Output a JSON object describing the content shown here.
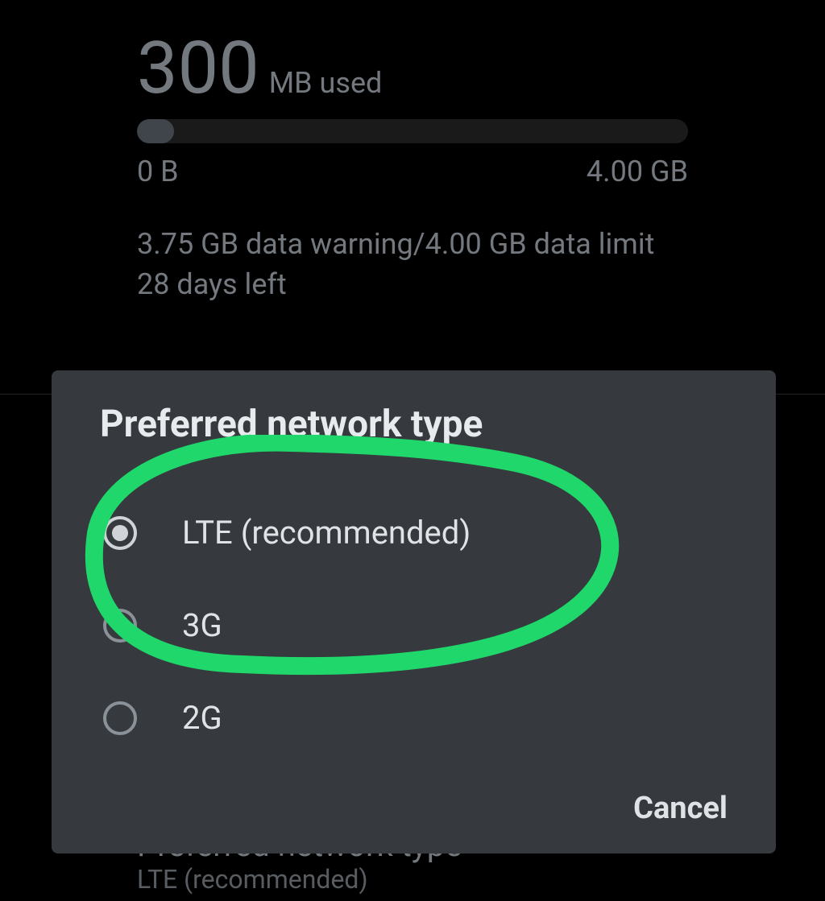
{
  "usage": {
    "amount": "300",
    "unit": "MB used",
    "min": "0 B",
    "max": "4.00 GB",
    "warning": "3.75 GB data warning/4.00 GB data limit",
    "days": "28 days left"
  },
  "bg": {
    "title": "Preferred network type",
    "subtitle": "LTE (recommended)"
  },
  "dialog": {
    "title": "Preferred network type",
    "options": {
      "lte": "LTE (recommended)",
      "g3": "3G",
      "g2": "2G"
    },
    "cancel": "Cancel"
  }
}
